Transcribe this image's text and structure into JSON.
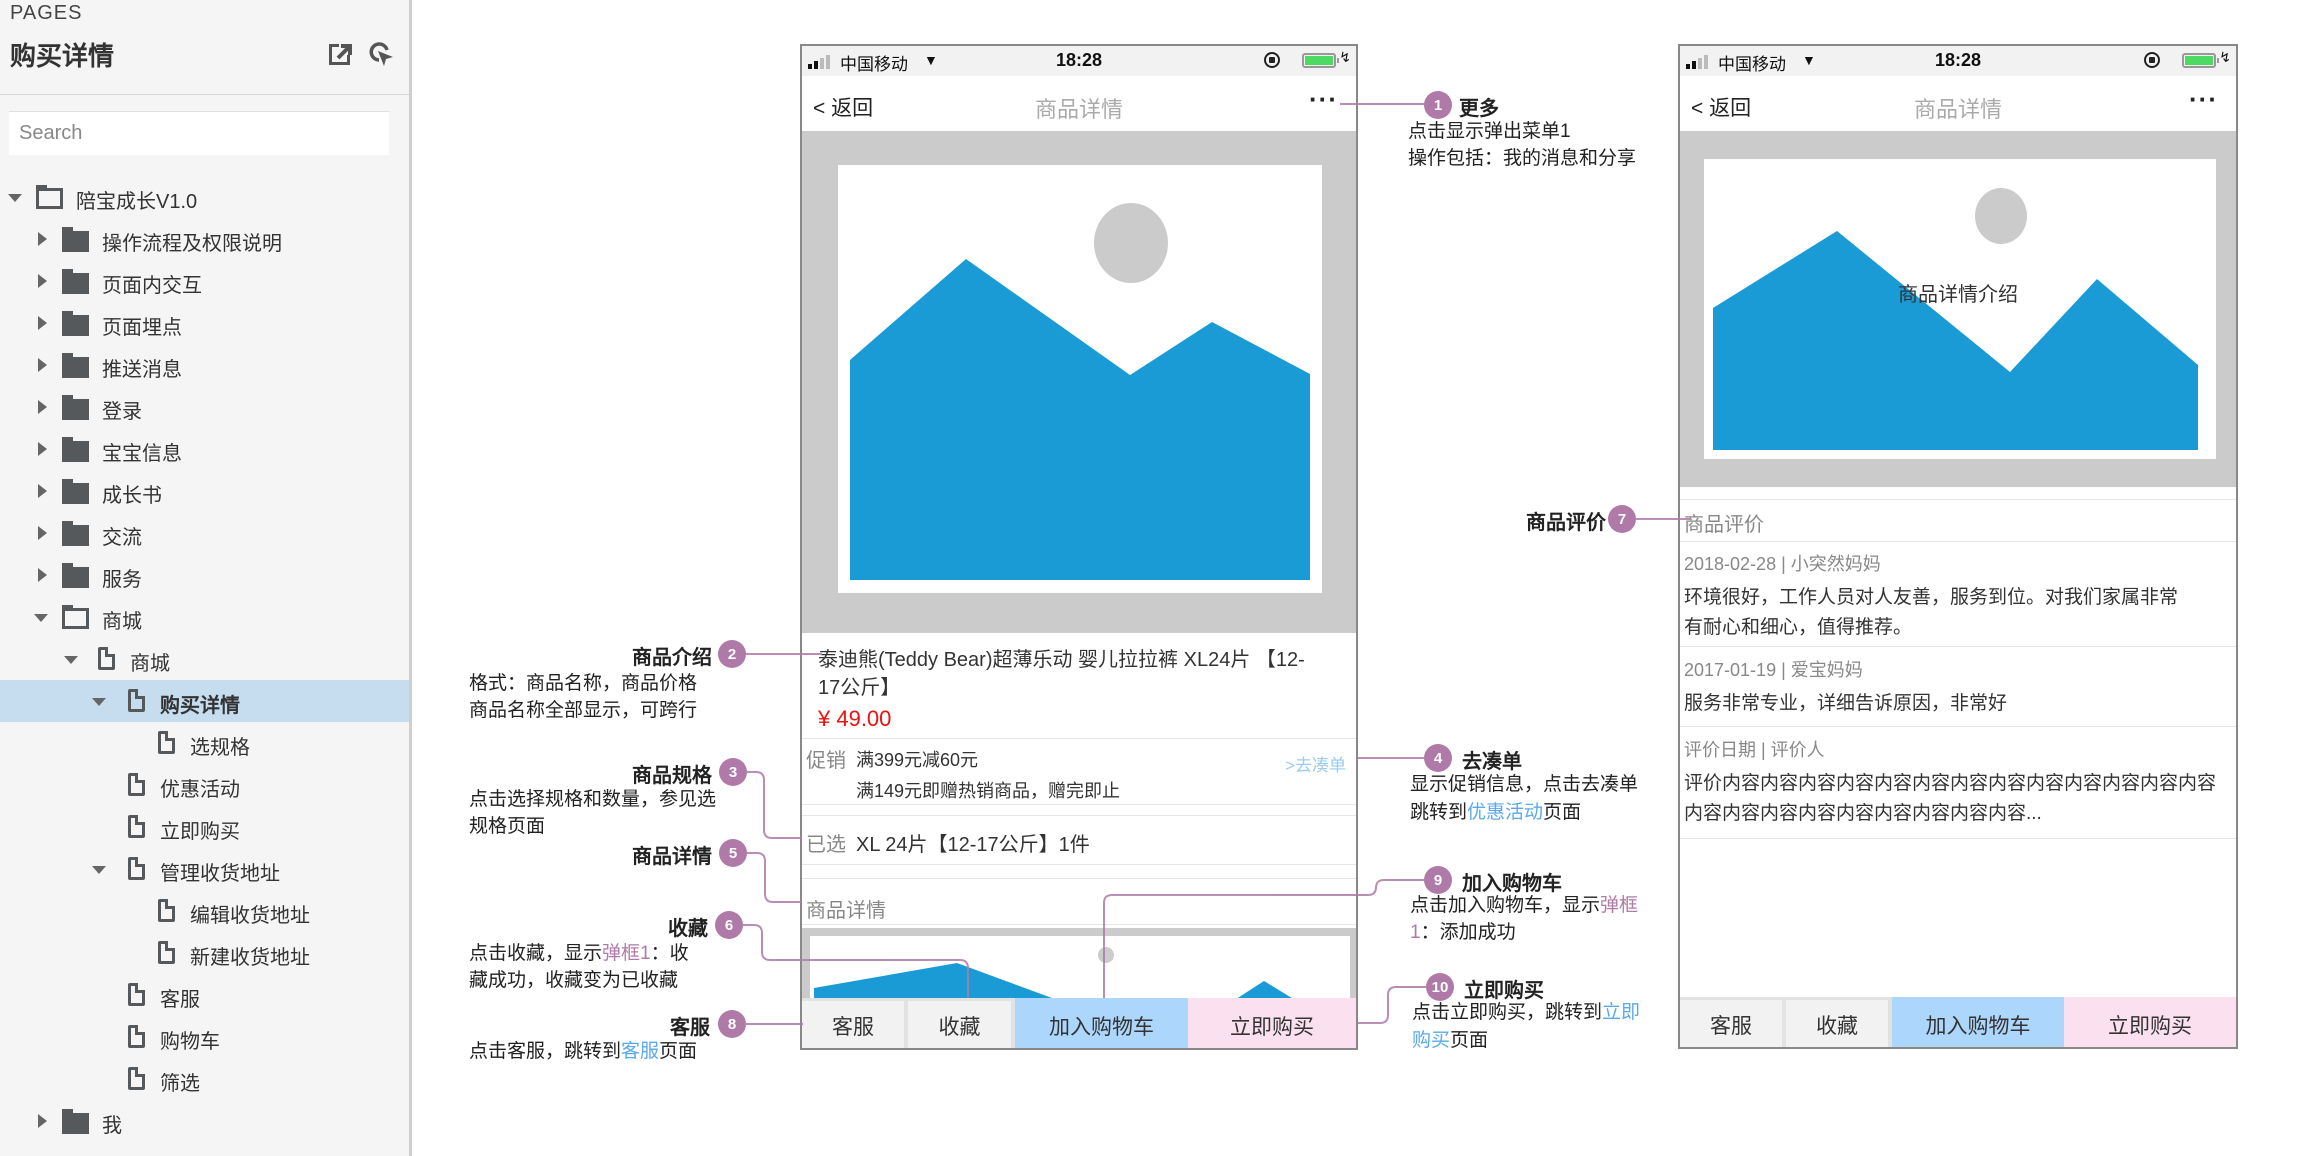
{
  "sidebar": {
    "section_label": "PAGES",
    "page_title": "购买详情",
    "search_placeholder": "Search",
    "tree": [
      {
        "label": "陪宝成长V1.0",
        "type": "folder-open",
        "level": 0,
        "caret": "down"
      },
      {
        "label": "操作流程及权限说明",
        "type": "folder",
        "level": 1,
        "caret": "right"
      },
      {
        "label": "页面内交互",
        "type": "folder",
        "level": 1,
        "caret": "right"
      },
      {
        "label": "页面埋点",
        "type": "folder",
        "level": 1,
        "caret": "right"
      },
      {
        "label": "推送消息",
        "type": "folder",
        "level": 1,
        "caret": "right"
      },
      {
        "label": "登录",
        "type": "folder",
        "level": 1,
        "caret": "right"
      },
      {
        "label": "宝宝信息",
        "type": "folder",
        "level": 1,
        "caret": "right"
      },
      {
        "label": "成长书",
        "type": "folder",
        "level": 1,
        "caret": "right"
      },
      {
        "label": "交流",
        "type": "folder",
        "level": 1,
        "caret": "right"
      },
      {
        "label": "服务",
        "type": "folder",
        "level": 1,
        "caret": "right"
      },
      {
        "label": "商城",
        "type": "folder-open",
        "level": 1,
        "caret": "down"
      },
      {
        "label": "商城",
        "type": "page",
        "level": 2,
        "caret": "down"
      },
      {
        "label": "购买详情",
        "type": "page",
        "level": 3,
        "caret": "down",
        "selected": true
      },
      {
        "label": "选规格",
        "type": "page",
        "level": 4,
        "caret": ""
      },
      {
        "label": "优惠活动",
        "type": "page",
        "level": 3,
        "caret": ""
      },
      {
        "label": "立即购买",
        "type": "page",
        "level": 3,
        "caret": ""
      },
      {
        "label": "管理收货地址",
        "type": "page",
        "level": 3,
        "caret": "down"
      },
      {
        "label": "编辑收货地址",
        "type": "page",
        "level": 4,
        "caret": ""
      },
      {
        "label": "新建收货地址",
        "type": "page",
        "level": 4,
        "caret": ""
      },
      {
        "label": "客服",
        "type": "page",
        "level": 3,
        "caret": ""
      },
      {
        "label": "购物车",
        "type": "page",
        "level": 3,
        "caret": ""
      },
      {
        "label": "筛选",
        "type": "page",
        "level": 3,
        "caret": ""
      },
      {
        "label": "我",
        "type": "folder",
        "level": 1,
        "caret": "right"
      }
    ]
  },
  "phone_common": {
    "carrier": "中国移动",
    "time": "18:28",
    "battery_level": 1.0,
    "back_label": "< 返回",
    "nav_title": "商品详情",
    "more_label": "···"
  },
  "phone1": {
    "product_title_line1": "泰迪熊(Teddy Bear)超薄乐动  婴儿拉拉裤 XL24片 【12-",
    "product_title_line2": "17公斤】",
    "price": "¥ 49.00",
    "promo_label": "促销",
    "promo_line1": "满399元减60元",
    "promo_line2": "满149元即赠热销商品，赠完即止",
    "promo_link": ">去凑单",
    "selected_label": "已选",
    "selected_value": "XL 24片【12-17公斤】1件",
    "detail_label": "商品详情"
  },
  "phone2": {
    "image_caption": "商品详情介绍",
    "reviews_header": "商品评价",
    "reviews": [
      {
        "meta": "2018-02-28 |  小突然妈妈",
        "line1": "环境很好，工作人员对人友善，服务到位。对我们家属非常",
        "line2": "有耐心和细心，值得推荐。"
      },
      {
        "meta": "2017-01-19 |  爱宝妈妈",
        "line1": "服务非常专业，详细告诉原因，非常好",
        "line2": ""
      },
      {
        "meta": "评价日期 | 评价人",
        "line1": "评价内容内容内容内容内容内容内容内容内容内容内容内容内容",
        "line2": "内容内容内容内容内容内容内容内容内容..."
      }
    ]
  },
  "bottom_bar": {
    "service": "客服",
    "favorite": "收藏",
    "add_to_cart": "加入购物车",
    "buy_now": "立即购买"
  },
  "annotations": {
    "a1": {
      "num": "1",
      "title": "更多",
      "line1": "点击显示弹出菜单1",
      "line2": "操作包括：我的消息和分享"
    },
    "a2": {
      "num": "2",
      "title": "商品介绍",
      "line1": "格式：商品名称，商品价格",
      "line2": "商品名称全部显示，可跨行"
    },
    "a3": {
      "num": "3",
      "title": "商品规格",
      "line1": "点击选择规格和数量，参见选",
      "line2": "规格页面"
    },
    "a4": {
      "num": "4",
      "title": "去凑单",
      "line1": "显示促销信息，点击去凑单",
      "line2_pre": "跳转到",
      "line2_link": "优惠活动",
      "line2_post": "页面"
    },
    "a5": {
      "num": "5",
      "title": "商品详情"
    },
    "a6": {
      "num": "6",
      "title": "收藏",
      "line1_pre": "点击收藏，显示",
      "line1_link": "弹框1",
      "line1_post": "：收",
      "line2": "藏成功，收藏变为已收藏"
    },
    "a7": {
      "num": "7",
      "title": "商品评价"
    },
    "a8": {
      "num": "8",
      "title": "客服",
      "line1_pre": "点击客服，跳转到",
      "line1_link": "客服",
      "line1_post": "页面"
    },
    "a9": {
      "num": "9",
      "title": "加入购物车",
      "line1_pre": "点击加入购物车，显示",
      "line1_link": "弹框",
      "line2_link": "1",
      "line2_post": "：添加成功"
    },
    "a10": {
      "num": "10",
      "title": "立即购买",
      "line1_pre": "点击立即购买，跳转到",
      "line1_link": "立即",
      "line2_link": "购买",
      "line2_post": "页面"
    }
  },
  "colors": {
    "annotation_accent": "#b07aa8",
    "link_blue": "#5aa9ee",
    "image_blue": "#1a9bd5",
    "price_red": "#ee1111",
    "selected_row": "#c6ddef",
    "add_to_cart_bg": "#add6fc",
    "buy_now_bg": "#fbe0ef"
  }
}
